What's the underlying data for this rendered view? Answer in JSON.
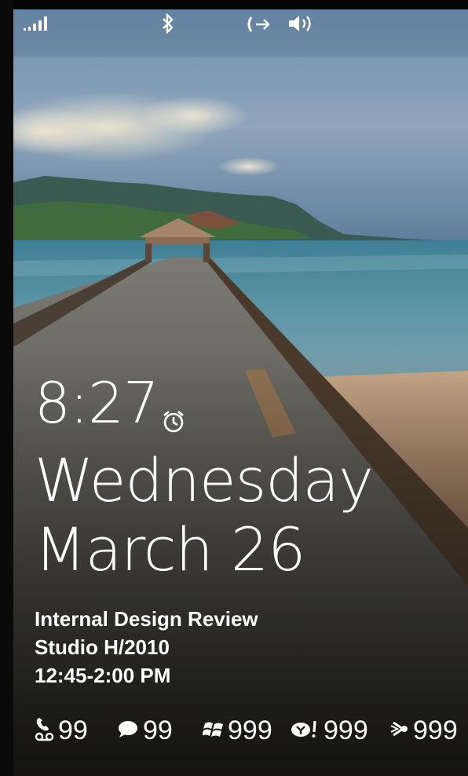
{
  "status": {
    "signal_icon": "signal-bars-icon",
    "bluetooth_icon": "bluetooth-icon",
    "call_forward_icon": "call-forwarding-icon",
    "volume_icon": "volume-icon"
  },
  "lock": {
    "time": "8:27",
    "day": "Wednesday",
    "date": "March 26",
    "alarm_icon": "alarm-clock-icon"
  },
  "appointment": {
    "title": "Internal Design Review",
    "location": "Studio H/2010",
    "time": "12:45-2:00 PM"
  },
  "notifications": [
    {
      "icon": "voicemail-icon",
      "count": "99"
    },
    {
      "icon": "message-icon",
      "count": "99"
    },
    {
      "icon": "windows-mail-icon",
      "count": "999"
    },
    {
      "icon": "yahoo-mail-icon",
      "count": "999"
    },
    {
      "icon": "exchange-mail-icon",
      "count": "999"
    }
  ]
}
